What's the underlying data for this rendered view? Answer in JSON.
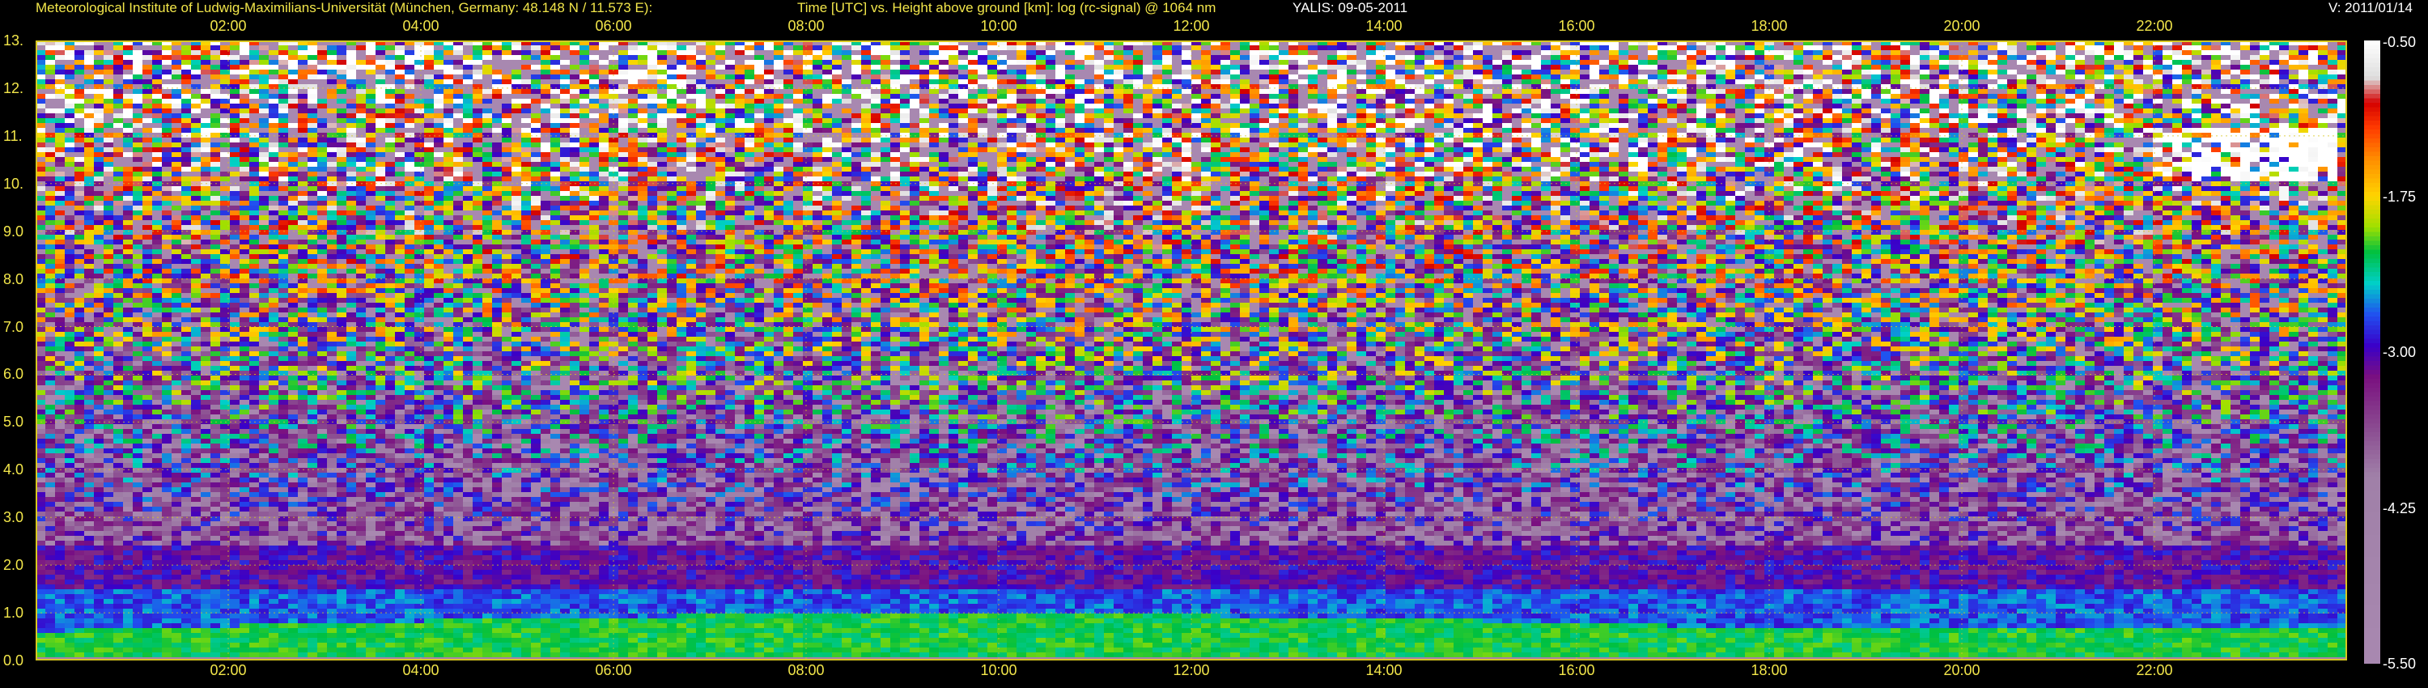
{
  "header": {
    "institute": "Meteorological Institute of Ludwig-Maximilians-Universität (München, Germany: 48.148 N / 11.573 E):",
    "plot_desc": "Time [UTC] vs. Height above ground [km]: log (rc-signal) @ 1064 nm",
    "instrument": "YALIS: 09-05-2011",
    "version": "V: 2011/01/14"
  },
  "colors": {
    "text_yellow": "#f2e64a",
    "text_white": "#ffffff",
    "grid_yellow": "#d8c820",
    "background": "#000000"
  },
  "chart_data": {
    "type": "heatmap",
    "title": "Time [UTC] vs. Height above ground [km]: log (rc-signal) @ 1064 nm",
    "x_tick_labels": [
      "02:00",
      "04:00",
      "06:00",
      "08:00",
      "10:00",
      "12:00",
      "14:00",
      "16:00",
      "18:00",
      "20:00",
      "22:00"
    ],
    "x_tick_hours": [
      2,
      4,
      6,
      8,
      10,
      12,
      14,
      16,
      18,
      20,
      22
    ],
    "xlim_hours": [
      0,
      24
    ],
    "y_tick_labels": [
      "0.0",
      "1.0",
      "2.0",
      "3.0",
      "4.0",
      "5.0",
      "6.0",
      "7.0",
      "8.0",
      "9.0",
      "10.",
      "11.",
      "12.",
      "13."
    ],
    "y_tick_values": [
      0,
      1,
      2,
      3,
      4,
      5,
      6,
      7,
      8,
      9,
      10,
      11,
      12,
      13
    ],
    "ylim_km": [
      0,
      13
    ],
    "grid": true,
    "colorbar": {
      "tick_labels": [
        "-0.50",
        "-1.75",
        "-3.00",
        "-4.25",
        "-5.50"
      ],
      "tick_values": [
        -0.5,
        -1.75,
        -3.0,
        -4.25,
        -5.5
      ],
      "range": [
        -5.5,
        -0.5
      ],
      "palette": [
        [
          -0.5,
          "#ffffff"
        ],
        [
          -0.8,
          "#dddddd"
        ],
        [
          -1.0,
          "#d40000"
        ],
        [
          -1.2,
          "#ff3a00"
        ],
        [
          -1.45,
          "#ff8c00"
        ],
        [
          -1.75,
          "#ffd400"
        ],
        [
          -2.0,
          "#9ee000"
        ],
        [
          -2.2,
          "#00c040"
        ],
        [
          -2.45,
          "#00d0c8"
        ],
        [
          -2.7,
          "#2050f0"
        ],
        [
          -2.95,
          "#3a00c8"
        ],
        [
          -3.2,
          "#7a1080"
        ],
        [
          -3.6,
          "#8a4a90"
        ],
        [
          -4.0,
          "#a080a8"
        ],
        [
          -5.5,
          "#a888b0"
        ]
      ],
      "location": "right"
    },
    "layers": [
      {
        "name": "near-surface green aerosol layer",
        "bottom_km": 0.05,
        "top_km_start": 0.6,
        "top_km_mid": 0.95,
        "top_km_end": 0.75,
        "value": -2.2
      },
      {
        "name": "blue transition layer",
        "bottom_km": 0.9,
        "top_km": 1.5,
        "value": -2.7
      },
      {
        "name": "magenta layer",
        "bottom_km": 1.3,
        "top_km": 2.4,
        "value": -3.1
      },
      {
        "name": "cirrus cloud",
        "x_hours": [
          22.0,
          23.9
        ],
        "y_km": [
          10.0,
          11.2
        ],
        "value": -0.6
      }
    ]
  }
}
